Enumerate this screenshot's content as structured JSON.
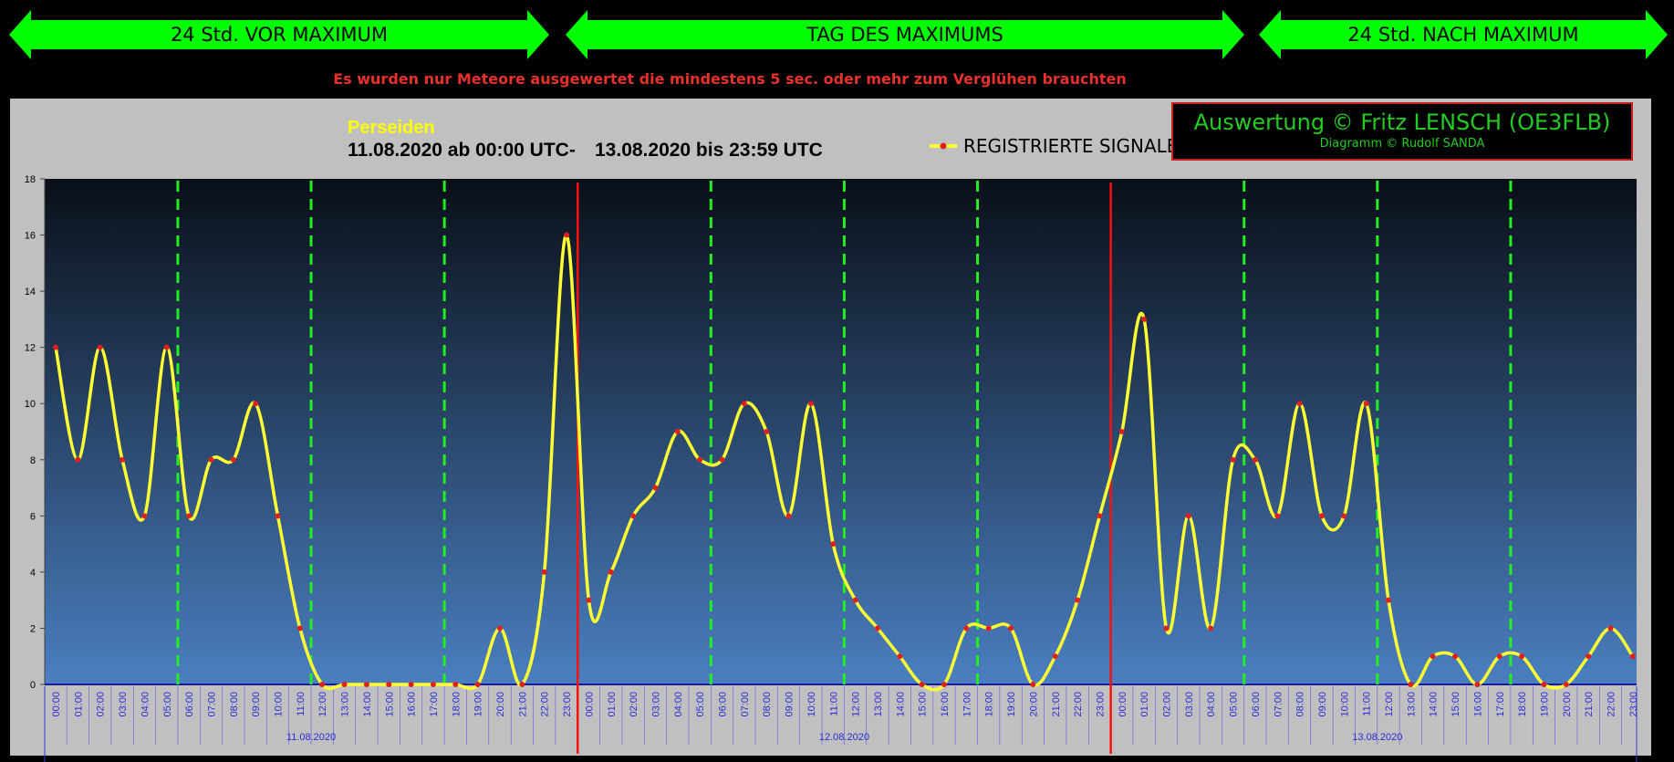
{
  "header": {
    "band_before": "24 Std. VOR MAXIMUM",
    "band_max": "TAG DES MAXIMUMS",
    "band_after": "24 Std. NACH MAXIMUM",
    "notice": "Es wurden nur Meteore ausgewertet die mindestens 5 sec. oder mehr zum Verglühen brauchten",
    "band_color": "#00ff00"
  },
  "info": {
    "shower": "Perseiden",
    "date_start": "11.08.2020 ab 00:00 UTC-",
    "date_end": "13.08.2020 bis 23:59 UTC"
  },
  "credit": {
    "main": "Auswertung © Fritz LENSCH (OE3FLB)",
    "sub": "Diagramm © Rudolf SANDA"
  },
  "chart_data": {
    "type": "line",
    "smooth": true,
    "ylim": [
      0,
      18
    ],
    "yticks": [
      "0",
      "2",
      "4",
      "6",
      "8",
      "10",
      "12",
      "14",
      "16",
      "18"
    ],
    "hours": [
      "00:00",
      "01:00",
      "02:00",
      "03:00",
      "04:00",
      "05:00",
      "06:00",
      "07:00",
      "08:00",
      "09:00",
      "10:00",
      "11:00",
      "12:00",
      "13:00",
      "14:00",
      "15:00",
      "16:00",
      "17:00",
      "18:00",
      "19:00",
      "20:00",
      "21:00",
      "22:00",
      "23:00"
    ],
    "days": [
      "11.08.2020",
      "12.08.2020",
      "13.08.2020"
    ],
    "series": [
      {
        "name": "REGISTRIERTE SIGNALE",
        "color": "#ffff33",
        "marker_color": "#e02020",
        "values": [
          12,
          8,
          12,
          8,
          6,
          12,
          6,
          8,
          8,
          10,
          6,
          2,
          0,
          0,
          0,
          0,
          0,
          0,
          0,
          0,
          2,
          0,
          4,
          16,
          3,
          4,
          6,
          7,
          9,
          8,
          8,
          10,
          9,
          6,
          10,
          5,
          3,
          2,
          1,
          0,
          0,
          2,
          2,
          2,
          0,
          1,
          3,
          6,
          9,
          13,
          2,
          6,
          2,
          8,
          8,
          6,
          10,
          6,
          6,
          10,
          3,
          0,
          1,
          1,
          0,
          1,
          1,
          0,
          0,
          1,
          2,
          1
        ]
      }
    ],
    "day_separators_after_hour_index": [
      23,
      47
    ],
    "dashed_guides_at_hours": [
      6,
      12,
      18
    ],
    "grid": false,
    "legend": "top-center",
    "background_gradient": [
      "#0a0f18",
      "#4a7fc0"
    ]
  }
}
